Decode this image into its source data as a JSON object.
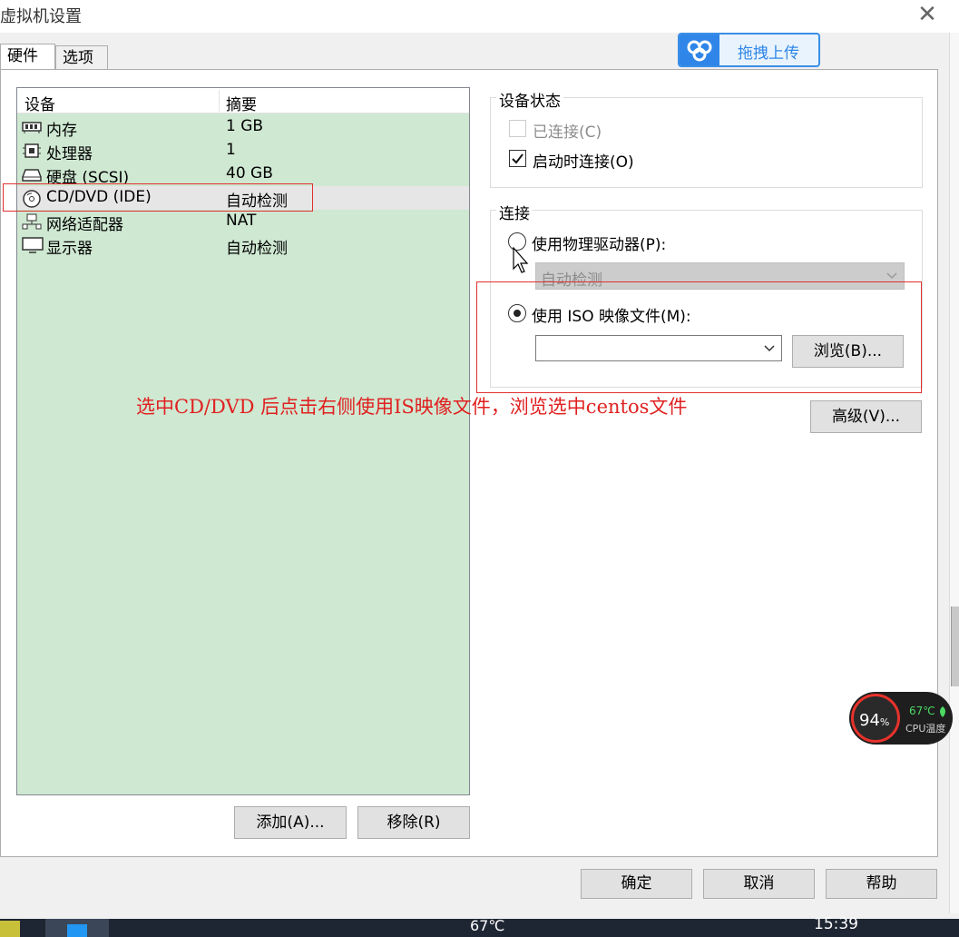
{
  "window": {
    "title": "虚拟机设置",
    "close_glyph": "✕"
  },
  "tabs": [
    {
      "label": "硬件",
      "active": true
    },
    {
      "label": "选项",
      "active": false
    }
  ],
  "baidu_upload": {
    "label": "拖拽上传"
  },
  "device_list": {
    "headers": [
      "设备",
      "摘要"
    ],
    "rows": [
      {
        "name": "内存",
        "summary": "1 GB",
        "icon": "memory-icon"
      },
      {
        "name": "处理器",
        "summary": "1",
        "icon": "cpu-icon"
      },
      {
        "name": "硬盘 (SCSI)",
        "summary": "40 GB",
        "icon": "hard-disk-icon"
      },
      {
        "name": "CD/DVD (IDE)",
        "summary": "自动检测",
        "icon": "cd-dvd-icon",
        "selected": true
      },
      {
        "name": "网络适配器",
        "summary": "NAT",
        "icon": "network-adapter-icon"
      },
      {
        "name": "显示器",
        "summary": "自动检测",
        "icon": "monitor-icon"
      }
    ]
  },
  "buttons": {
    "add": "添加(A)...",
    "remove": "移除(R)",
    "ok": "确定",
    "cancel": "取消",
    "help": "帮助",
    "browse": "浏览(B)...",
    "advanced": "高级(V)..."
  },
  "device_status": {
    "label": "设备状态",
    "connected": {
      "label": "已连接(C)",
      "checked": false,
      "disabled": true
    },
    "connect_at_power_on": {
      "label": "启动时连接(O)",
      "checked": true
    }
  },
  "connection": {
    "label": "连接",
    "physical": {
      "label": "使用物理驱动器(P):",
      "selected": false,
      "drive_value": "自动检测"
    },
    "iso": {
      "label": "使用 ISO 映像文件(M):",
      "selected": true,
      "path_value": ""
    }
  },
  "annotation": "选中CD/DVD 后点击右侧使用IS映像文件，浏览选中centos文件",
  "cpu_widget": {
    "percent": "94",
    "percent_unit": "%",
    "temp": "67℃",
    "label": "CPU温度"
  },
  "taskbar": {
    "temp": "67℃",
    "time": "15:39"
  },
  "colors": {
    "accent_red": "#e03030",
    "device_list_bg": "#cfe8d2",
    "baidu_blue": "#2f86e8"
  }
}
